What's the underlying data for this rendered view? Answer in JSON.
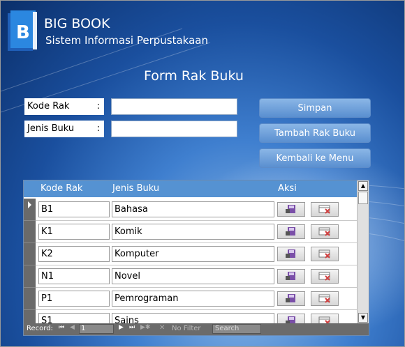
{
  "app": {
    "title": "BIG BOOK",
    "subtitle": "Sistem Informasi Perpustakaan",
    "logo_letter": "B"
  },
  "form": {
    "title": "Form Rak Buku",
    "fields": [
      {
        "label": "Kode Rak",
        "colon": ":",
        "value": ""
      },
      {
        "label": "Jenis Buku",
        "colon": ":",
        "value": ""
      }
    ]
  },
  "buttons": {
    "save": "Simpan",
    "add": "Tambah Rak Buku",
    "back": "Kembali ke Menu"
  },
  "grid": {
    "headers": {
      "code": "Kode Rak",
      "type": "Jenis Buku",
      "action": "Aksi"
    },
    "rows": [
      {
        "code": "B1",
        "type": "Bahasa"
      },
      {
        "code": "K1",
        "type": "Komik"
      },
      {
        "code": "K2",
        "type": "Komputer"
      },
      {
        "code": "N1",
        "type": "Novel"
      },
      {
        "code": "P1",
        "type": "Pemrograman"
      },
      {
        "code": "S1",
        "type": "Sains"
      }
    ]
  },
  "navbar": {
    "record_label": "Record:",
    "current": "1",
    "filter": "No Filter",
    "search": "Search"
  },
  "colors": {
    "header": "#5592d2",
    "button": "#6a9ad8",
    "edit_icon": "#7a4fa8",
    "delete_icon": "#d04040"
  }
}
